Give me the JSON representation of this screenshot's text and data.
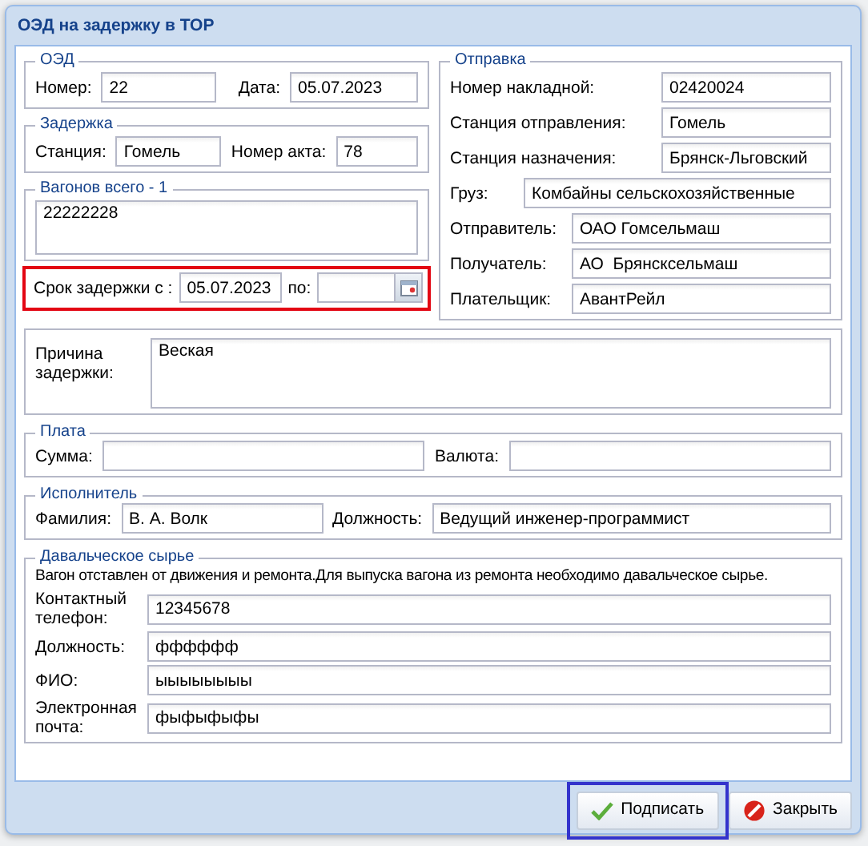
{
  "window": {
    "title": "ОЭД на задержку в ТОР"
  },
  "oed": {
    "legend": "ОЭД",
    "fields": [
      {
        "label": "Номер:",
        "value": "22"
      },
      {
        "label": "Дата:",
        "value": "05.07.2023"
      }
    ]
  },
  "delay": {
    "legend": "Задержка",
    "fields": [
      {
        "label": "Станция:",
        "value": "Гомель"
      },
      {
        "label": "Номер акта:",
        "value": "78"
      }
    ]
  },
  "wagons": {
    "legend": "Вагонов всего - 1",
    "value": "22222228"
  },
  "shipment": {
    "legend": "Отправка",
    "fields": [
      {
        "label": "Номер накладной:",
        "value": "02420024"
      },
      {
        "label": "Станция отправления:",
        "value": "Гомель"
      },
      {
        "label": "Станция назначения:",
        "value": "Брянск-Льговский"
      },
      {
        "label": "Груз:",
        "value": "Комбайны сельскохозяйственные"
      },
      {
        "label": "Отправитель:",
        "value": "ОАО Гомсельмаш"
      },
      {
        "label": "Получатель:",
        "value": "АО  Брянсксельмаш"
      },
      {
        "label": "Плательщик:",
        "value": "АвантРейл"
      }
    ]
  },
  "period": {
    "label_from": "Срок задержки с :",
    "from_value": "05.07.2023",
    "label_to": "по:",
    "highlighted": true
  },
  "reason": {
    "label": "Причина задержки:",
    "value": "Веская"
  },
  "payment": {
    "legend": "Плата",
    "fields": [
      {
        "label": "Сумма:"
      },
      {
        "label": "Валюта:"
      }
    ]
  },
  "executor": {
    "legend": "Исполнитель",
    "fields": [
      {
        "label": "Фамилия:",
        "value": "В. А. Волк"
      },
      {
        "label": "Должность:",
        "value": "Ведущий инженер-программист"
      }
    ]
  },
  "raw_material": {
    "legend": "Давальческое сырье",
    "note": "Вагон отставлен от движения и ремонта.Для выпуска вагона из ремонта необходимо давальческое сырье.",
    "fields": [
      {
        "label": "Контактный телефон:",
        "value": "12345678"
      },
      {
        "label": "Должность:",
        "value": "фффффф"
      },
      {
        "label": "ФИО:",
        "value": "ыыыыыыыы"
      },
      {
        "label": "Электронная почта:",
        "value": "фыфыфыфы"
      }
    ]
  },
  "buttons": [
    {
      "label": "Подписать",
      "kind": "sign",
      "highlighted": true
    },
    {
      "label": "Закрыть",
      "kind": "close",
      "highlighted": false
    }
  ]
}
